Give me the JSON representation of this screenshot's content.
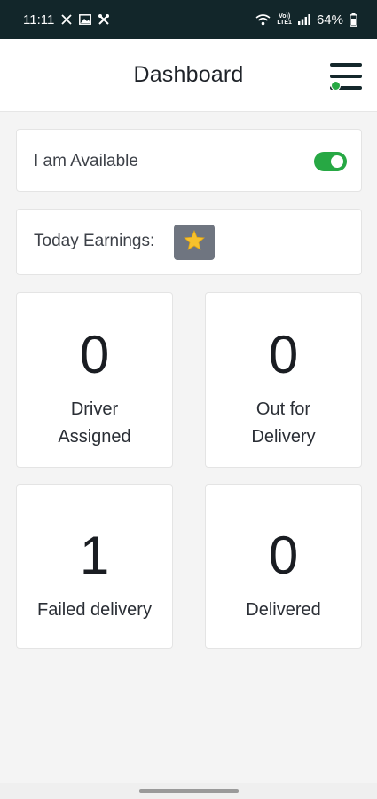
{
  "status_bar": {
    "time": "11:11",
    "battery": "64%",
    "network_top": "Vo))",
    "network_bottom": "LTE1",
    "background": "#12262a"
  },
  "header": {
    "title": "Dashboard",
    "menu_icon": "hamburger-menu-icon",
    "online_indicator_color": "#27a844"
  },
  "availability": {
    "label": "I am Available",
    "toggle_on": true,
    "toggle_color": "#27a844"
  },
  "earnings": {
    "label": "Today Earnings:",
    "icon": "star-icon",
    "badge_color": "#6f7580",
    "star_color": "#f7c12c"
  },
  "stats": [
    {
      "value": "0",
      "label": "Driver\nAssigned"
    },
    {
      "value": "0",
      "label": "Out for\nDelivery"
    },
    {
      "value": "1",
      "label": "Failed delivery"
    },
    {
      "value": "0",
      "label": "Delivered"
    }
  ]
}
